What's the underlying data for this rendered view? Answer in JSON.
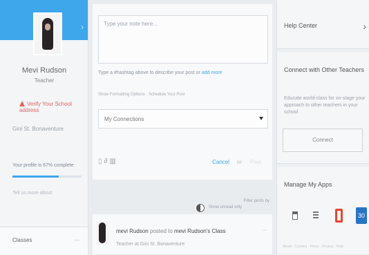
{
  "profile": {
    "name": "Mevi Rudson",
    "role": "Teacher",
    "school_warning": "Verify Your School address",
    "school_name": "Gini St. Bonaventure",
    "completion_label": "Your profile is 67% complete",
    "completion": 0.67,
    "tell_more": "Tell us more about",
    "classes_label": "Classes",
    "classes_toggle": "—"
  },
  "composer": {
    "note_placeholder": "Type your note here...",
    "meaning_prefix": "Type a #hashtag above to describe your post or ",
    "meaning_link": "add more",
    "formatting_hint": "Show Formatting Options · Schedule Your Post",
    "connections_select": "My Connections",
    "cancel": "Cancel",
    "or": "or",
    "post": "Post"
  },
  "feed": {
    "filter_link": "Filter posts by",
    "toggle_label": "Show unread only",
    "post": {
      "author": "mevi Rudson",
      "verb": " posted to ",
      "target": "mevi Rudson's Class",
      "subline": "Teacher at Gini St. Bonaventure",
      "menu": "···"
    }
  },
  "right": {
    "help_center": "Help Center",
    "connect_title": "Connect with Other Teachers",
    "connect_desc": "Educate world-class for on-stage your approach to other teachers in your school",
    "connect_button": "Connect",
    "apps_title": "Manage My Apps",
    "calendar_day": "30",
    "footer": "About · Careers · Press · Privacy · Help"
  },
  "colors": {
    "accent": "#3ea6ea",
    "warning": "#e06161",
    "office": "#e8442d",
    "calendar": "#2774c5"
  }
}
